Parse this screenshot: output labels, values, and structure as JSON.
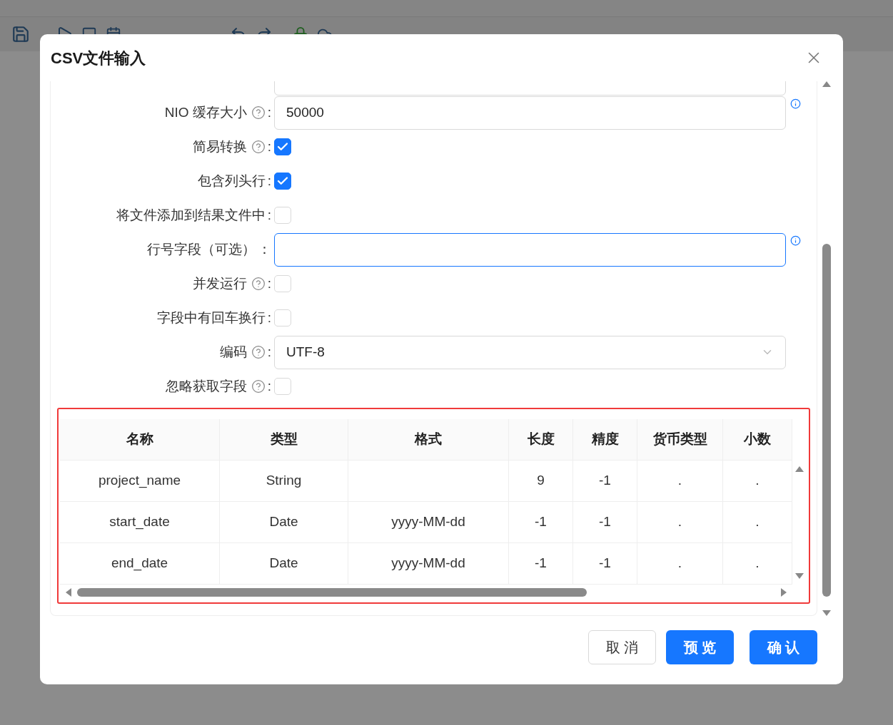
{
  "dialog": {
    "title": "CSV文件输入"
  },
  "fields": [
    {
      "kind": "input",
      "help": false,
      "info": false,
      "focused": false
    },
    {
      "kind": "input",
      "label": "NIO 缓存大小",
      "colon": ":",
      "help": true,
      "info": true,
      "focused": false,
      "value": "50000"
    },
    {
      "kind": "checkbox",
      "label": "简易转换",
      "colon": ":",
      "help": true,
      "checked": true
    },
    {
      "kind": "checkbox",
      "label": "包含列头行",
      "colon": ":",
      "help": false,
      "checked": true
    },
    {
      "kind": "checkbox",
      "label": "将文件添加到结果文件中",
      "colon": ":",
      "help": false,
      "checked": false
    },
    {
      "kind": "input",
      "label": "行号字段（可选）",
      "colon": "：",
      "help": false,
      "info": true,
      "focused": true
    },
    {
      "kind": "checkbox",
      "label": "并发运行",
      "colon": ":",
      "help": true,
      "checked": false
    },
    {
      "kind": "checkbox",
      "label": "字段中有回车换行",
      "colon": ":",
      "help": false,
      "checked": false
    },
    {
      "kind": "select",
      "label": "编码",
      "colon": ":",
      "help": true,
      "value": "UTF-8"
    },
    {
      "kind": "checkbox",
      "label": "忽略获取字段",
      "colon": ":",
      "help": true,
      "checked": false
    }
  ],
  "table": {
    "columns": [
      "名称",
      "类型",
      "格式",
      "长度",
      "精度",
      "货币类型",
      "小数"
    ],
    "rows": [
      [
        "project_name",
        "String",
        null,
        "9",
        "-1",
        ".",
        "."
      ],
      [
        "start_date",
        "Date",
        "yyyy-MM-dd",
        "-1",
        "-1",
        ".",
        "."
      ],
      [
        "end_date",
        "Date",
        "yyyy-MM-dd",
        "-1",
        "-1",
        ".",
        "."
      ]
    ]
  },
  "buttons": [
    {
      "label": "取 消",
      "kind": "default"
    },
    {
      "label": "预 览",
      "kind": "primary"
    },
    {
      "label": "确 认",
      "kind": "primary"
    }
  ]
}
